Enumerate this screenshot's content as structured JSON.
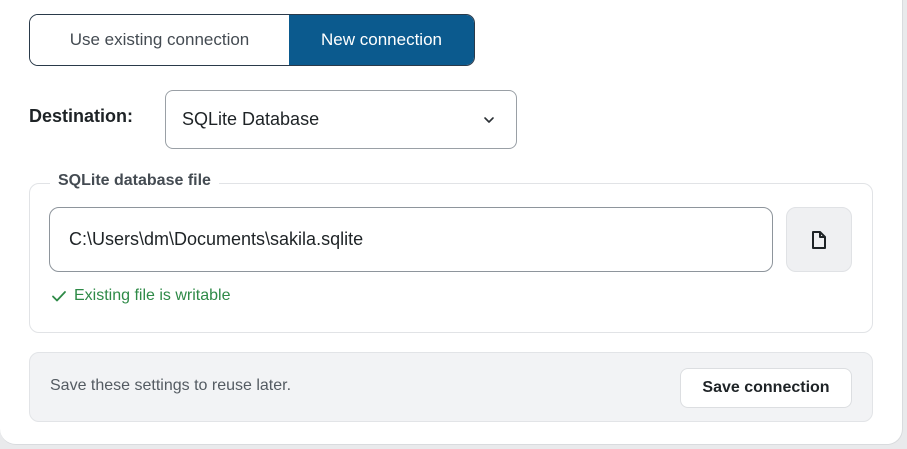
{
  "connection_mode": {
    "options": [
      {
        "label": "Use existing connection",
        "selected": false
      },
      {
        "label": "New connection",
        "selected": true
      }
    ]
  },
  "destination": {
    "label": "Destination:",
    "selected": "SQLite Database",
    "icon": "chevron-down-icon"
  },
  "sqlite_file": {
    "legend": "SQLite database file",
    "path": "C:\\Users\\dm\\Documents\\sakila.sqlite",
    "browse_icon": "file-icon",
    "status_icon": "check-icon",
    "status_text": "Existing file is writable",
    "status_color": "#2e8a47"
  },
  "footer": {
    "hint": "Save these settings to reuse later.",
    "save_label": "Save connection"
  },
  "colors": {
    "accent": "#0b5a8e",
    "success": "#2e8a47"
  }
}
